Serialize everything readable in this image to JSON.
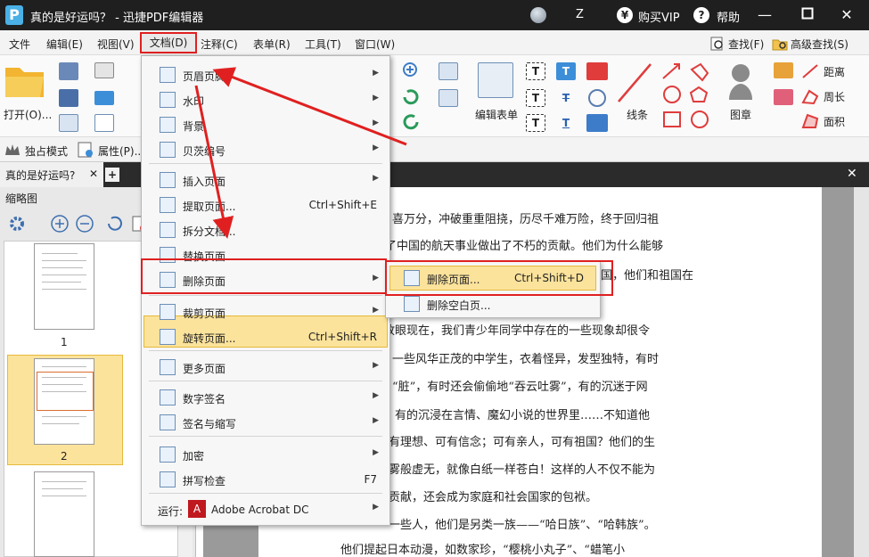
{
  "titlebar": {
    "title": "真的是好运吗？ - 迅捷PDF编辑器",
    "user_letter": "Z",
    "vip_label": "购买VIP",
    "help_label": "帮助"
  },
  "menubar": {
    "items": [
      "文件",
      "编辑(E)",
      "视图(V)",
      "文档(D)",
      "注释(C)",
      "表单(R)",
      "工具(T)",
      "窗口(W)"
    ],
    "find_label": "查找(F)",
    "advanced_find_label": "高级查找(S)"
  },
  "ribbon": {
    "open_label": "打开(O)...",
    "edit_form_label": "编辑表单",
    "lines_label": "线条",
    "stamp_label": "图章",
    "distance_label": "距离",
    "perimeter_label": "周长",
    "area_label": "面积"
  },
  "row3": {
    "exclusive_mode": "独占模式",
    "properties": "属性(P)..."
  },
  "tab": {
    "title": "真的是好运吗?"
  },
  "sidebar": {
    "title": "缩略图",
    "pages": [
      "1",
      "2"
    ]
  },
  "document_menu": {
    "items": [
      {
        "label": "页眉页脚",
        "submenu": true
      },
      {
        "label": "水印",
        "submenu": true
      },
      {
        "label": "背景",
        "submenu": true
      },
      {
        "label": "贝茨编号",
        "submenu": true
      },
      {
        "label": "插入页面",
        "submenu": true
      },
      {
        "label": "提取页面...",
        "shortcut": "Ctrl+Shift+E"
      },
      {
        "label": "拆分文档..."
      },
      {
        "label": "替换页面..."
      },
      {
        "label": "删除页面",
        "submenu": true
      },
      {
        "label": "裁剪页面",
        "submenu": true
      },
      {
        "label": "旋转页面...",
        "shortcut": "Ctrl+Shift+R"
      },
      {
        "label": "更多页面",
        "submenu": true
      },
      {
        "label": "数字签名",
        "submenu": true
      },
      {
        "label": "签名与缩写",
        "submenu": true
      },
      {
        "label": "加密",
        "submenu": true
      },
      {
        "label": "拼写检查",
        "shortcut": "F7"
      }
    ],
    "run_label": "运行:",
    "run_app": "Adobe Acrobat DC"
  },
  "delete_submenu": {
    "items": [
      {
        "label": "删除页面...",
        "shortcut": "Ctrl+Shift+D"
      },
      {
        "label": "删除空白页..."
      }
    ]
  },
  "document_text": [
    "喜万分，冲破重重阻挠，历尽千难万险，终于回归祖",
    "了中国的航天事业做出了不朽的贡献。他们为什么能够",
    "国，他们和祖国在",
    "放眼现在，我们青少年同学中存在的一些现象却很令",
    "一些风华正茂的中学生，衣着怪异，发型独特，有时",
    "“脏”，有时还会偷偷地“吞云吐雾”，有的沉迷于网",
    "，有的沉浸在言情、魔幻小说的世界里……不知道他",
    "有理想、可有信念；可有亲人，可有祖国？他们的生",
    "雾般虚无，就像白纸一样苍白！这样的人不仅不能为",
    "贡献，还会成为家庭和社会国家的包袱。",
    "一些人，他们是另类一族——“哈日族”、“哈韩族”。",
    "他们提起日本动漫，如数家珍，“樱桃小丸子”、“蜡笔小"
  ]
}
